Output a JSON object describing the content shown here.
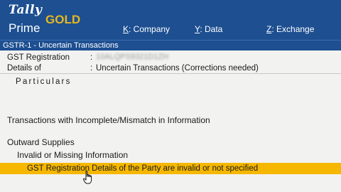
{
  "app": {
    "logo_tally": "Tally",
    "logo_prime": "Prime",
    "logo_gold": "GOLD"
  },
  "menu": [
    {
      "key": "K",
      "label": ": Company"
    },
    {
      "key": "Y",
      "label": ": Data"
    },
    {
      "key": "Z",
      "label": ": Exchange"
    }
  ],
  "window": {
    "title": "GSTR-1 - Uncertain Transactions"
  },
  "header": {
    "gst_registration_label": "GST Registration",
    "gst_registration_value": "10ALQPS9321D1ZH",
    "details_label": "Details of",
    "details_value": "Uncertain Transactions (Corrections needed)",
    "colon": ":"
  },
  "table": {
    "column_header": "Particulars",
    "rows": {
      "incomplete": "Transactions with Incomplete/Mismatch in Information",
      "outward": "Outward Supplies",
      "invalid": "Invalid or Missing Information",
      "selected": "GST Registration Details of the Party are invalid or not specified"
    }
  },
  "colors": {
    "header_bg": "#1d4f91",
    "gold_text": "#e6b81e",
    "selection_bg": "#f5b700",
    "page_bg": "#f2f2f0"
  }
}
